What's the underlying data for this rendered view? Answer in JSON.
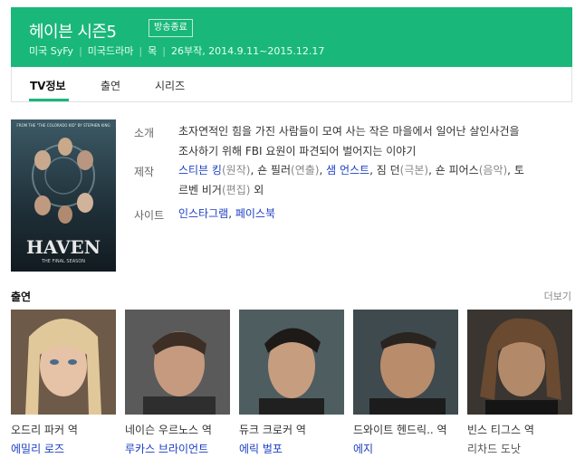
{
  "header": {
    "title": "헤이븐 시즌5",
    "badge": "방송종료",
    "meta": [
      "미국 SyFy",
      "미국드라마",
      "목",
      "26부작, 2014.9.11~2015.12.17"
    ]
  },
  "tabs": [
    "TV정보",
    "출연",
    "시리즈"
  ],
  "poster": {
    "top_text": "FROM THE \"THE COLORADO KID\" BY STEPHEN KING",
    "logo": "HAVEN",
    "subtitle": "THE FINAL SEASON"
  },
  "info": {
    "intro_label": "소개",
    "intro_line1": "초자연적인 힘을 가진 사람들이 모여 사는 작은 마을에서 일어난 살인사건을",
    "intro_line2": "조사하기 위해 FBI 요원이 파견되어 벌어지는 이야기",
    "prod_label": "제작",
    "prod": [
      {
        "name": "스티븐 킹",
        "role": "(원작)",
        "link": true
      },
      {
        "name": "숀 필러",
        "role": "(연출)",
        "link": false
      },
      {
        "name": "샘 언스트",
        "role": "",
        "link": true
      },
      {
        "name": "짐 던",
        "role": "(극본)",
        "link": false
      },
      {
        "name": "숀 피어스",
        "role": "(음악)",
        "link": false
      }
    ],
    "prod_tail1": "토",
    "prod_line2_name": "르벤 비거",
    "prod_line2_role": "(편집)",
    "prod_line2_suffix": " 외",
    "site_label": "사이트",
    "site_instagram": "인스타그램",
    "site_facebook": "페이스북"
  },
  "cast_section": {
    "title": "출연",
    "more": "더보기",
    "items": [
      {
        "role": "오드리 파커 역",
        "actor": "에밀리 로즈",
        "actor_link": true
      },
      {
        "role": "네이슨 우르노스 역",
        "actor": "루카스 브라이언트",
        "actor_link": true
      },
      {
        "role": "듀크 크로커 역",
        "actor": "에릭 벌포",
        "actor_link": true
      },
      {
        "role": "드와이트 헨드릭.. 역",
        "actor": "에지",
        "actor_link": true
      },
      {
        "role": "빈스 티그스 역",
        "actor": "리차드 도낫",
        "actor_link": false
      }
    ]
  },
  "colors": {
    "accent": "#19b77a",
    "link": "#1a3ec4"
  }
}
